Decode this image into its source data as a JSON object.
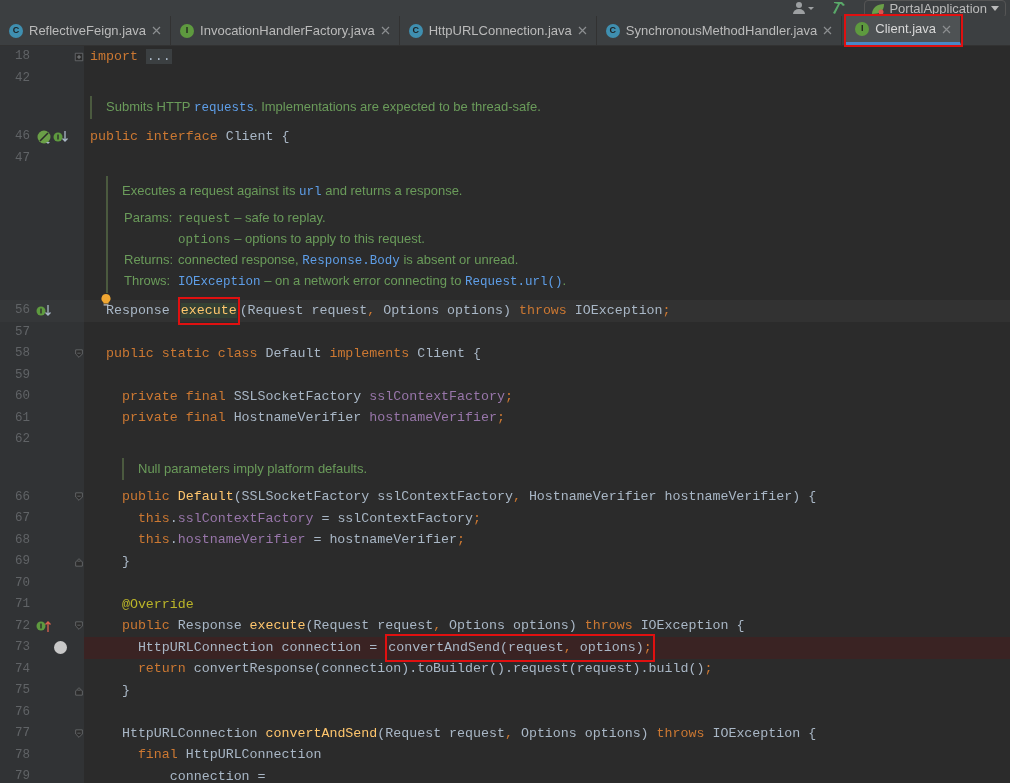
{
  "toolbar": {
    "run_config": "PortalApplication"
  },
  "tabs": [
    {
      "label": "ReflectiveFeign.java",
      "icon": "C",
      "kind": "class",
      "selected": false,
      "annotated": false
    },
    {
      "label": "InvocationHandlerFactory.java",
      "icon": "I",
      "kind": "interface",
      "selected": false,
      "annotated": false
    },
    {
      "label": "HttpURLConnection.java",
      "icon": "C",
      "kind": "class",
      "selected": false,
      "annotated": false
    },
    {
      "label": "SynchronousMethodHandler.java",
      "icon": "C",
      "kind": "class",
      "selected": false,
      "annotated": false
    },
    {
      "label": "Client.java",
      "icon": "I",
      "kind": "interface",
      "selected": true,
      "annotated": true
    }
  ],
  "editor": {
    "lines": [
      {
        "kind": "code",
        "number": "18",
        "fold": {
          "kind": "collapsed"
        },
        "tokens": [
          {
            "t": "import ",
            "kind": "kw"
          },
          {
            "t": "...",
            "kind": "folded"
          }
        ]
      },
      {
        "kind": "code",
        "number": "42"
      },
      {
        "kind": "doc",
        "rows": [
          {
            "parts": [
              {
                "t": "Submits HTTP "
              },
              {
                "t": "requests",
                "kind": "link"
              },
              {
                "t": ". Implementations are expected to be thread-safe."
              }
            ]
          }
        ]
      },
      {
        "kind": "code",
        "number": "46",
        "gutter": [
          {
            "kind": "leaf"
          },
          {
            "kind": "impl-down"
          }
        ],
        "tokens": [
          {
            "t": "public ",
            "kind": "kw"
          },
          {
            "t": "interface ",
            "kind": "kw"
          },
          {
            "t": "Client {"
          }
        ]
      },
      {
        "kind": "code",
        "number": "47"
      },
      {
        "kind": "doc",
        "bulb": true,
        "rows": [
          {
            "parts": [
              {
                "t": "Executes a request against its "
              },
              {
                "t": "url",
                "kind": "link"
              },
              {
                "t": " and returns a response."
              }
            ]
          },
          {
            "label": "Params:",
            "parts": [
              {
                "t": "request",
                "kind": "param"
              },
              {
                "t": " – safe to replay."
              }
            ]
          },
          {
            "parts": [
              {
                "t": "options",
                "kind": "param"
              },
              {
                "t": " – options to apply to this request."
              }
            ]
          },
          {
            "label": "Returns:",
            "parts": [
              {
                "t": "connected response, "
              },
              {
                "t": "Response.Body",
                "kind": "link"
              },
              {
                "t": " is absent or unread."
              }
            ]
          },
          {
            "label": "Throws:",
            "parts": [
              {
                "t": "IOException",
                "kind": "link"
              },
              {
                "t": " – on a network error connecting to "
              },
              {
                "t": "Request.url()",
                "kind": "link"
              },
              {
                "t": "."
              }
            ]
          }
        ]
      },
      {
        "kind": "code",
        "number": "56",
        "current": true,
        "gutter": [
          {
            "kind": "impl-down"
          }
        ],
        "tokens": [
          {
            "t": "  Response "
          },
          {
            "t": "execute",
            "kind": "fn",
            "boxed": true,
            "caret": true
          },
          {
            "t": "(Request request"
          },
          {
            "t": ", ",
            "kind": "kw"
          },
          {
            "t": "Options options) "
          },
          {
            "t": "throws ",
            "kind": "kw"
          },
          {
            "t": "IOException"
          },
          {
            "t": ";",
            "kind": "kw"
          }
        ]
      },
      {
        "kind": "code",
        "number": "57"
      },
      {
        "kind": "code",
        "number": "58",
        "fold": {
          "kind": "start"
        },
        "tokens": [
          {
            "t": "  public static class ",
            "kind": "kw"
          },
          {
            "t": "Default "
          },
          {
            "t": "implements ",
            "kind": "kw"
          },
          {
            "t": "Client {"
          }
        ]
      },
      {
        "kind": "code",
        "number": "59"
      },
      {
        "kind": "code",
        "number": "60",
        "tokens": [
          {
            "t": "    private final ",
            "kind": "kw"
          },
          {
            "t": "SSLSocketFactory "
          },
          {
            "t": "sslContextFactory",
            "kind": "field"
          },
          {
            "t": ";",
            "kind": "kw"
          }
        ]
      },
      {
        "kind": "code",
        "number": "61",
        "tokens": [
          {
            "t": "    private final ",
            "kind": "kw"
          },
          {
            "t": "HostnameVerifier "
          },
          {
            "t": "hostnameVerifier",
            "kind": "field"
          },
          {
            "t": ";",
            "kind": "kw"
          }
        ]
      },
      {
        "kind": "code",
        "number": "62"
      },
      {
        "kind": "doc",
        "rows": [
          {
            "parts": [
              {
                "t": "Null parameters imply platform defaults."
              }
            ]
          }
        ]
      },
      {
        "kind": "code",
        "number": "66",
        "fold": {
          "kind": "start"
        },
        "tokens": [
          {
            "t": "    public ",
            "kind": "kw"
          },
          {
            "t": "Default",
            "kind": "fn"
          },
          {
            "t": "(SSLSocketFactory sslContextFactory"
          },
          {
            "t": ", ",
            "kind": "kw"
          },
          {
            "t": "HostnameVerifier hostnameVerifier) {"
          }
        ]
      },
      {
        "kind": "code",
        "number": "67",
        "tokens": [
          {
            "t": "      this",
            "kind": "kw"
          },
          {
            "t": "."
          },
          {
            "t": "sslContextFactory",
            "kind": "field"
          },
          {
            "t": " = sslContextFactory"
          },
          {
            "t": ";",
            "kind": "kw"
          }
        ]
      },
      {
        "kind": "code",
        "number": "68",
        "tokens": [
          {
            "t": "      this",
            "kind": "kw"
          },
          {
            "t": "."
          },
          {
            "t": "hostnameVerifier",
            "kind": "field"
          },
          {
            "t": " = hostnameVerifier"
          },
          {
            "t": ";",
            "kind": "kw"
          }
        ]
      },
      {
        "kind": "code",
        "number": "69",
        "fold": {
          "kind": "end"
        },
        "tokens": [
          {
            "t": "    }"
          }
        ]
      },
      {
        "kind": "code",
        "number": "70"
      },
      {
        "kind": "code",
        "number": "71",
        "tokens": [
          {
            "t": "    @Override",
            "kind": "ann"
          }
        ]
      },
      {
        "kind": "code",
        "number": "72",
        "fold": {
          "kind": "start"
        },
        "gutter": [
          {
            "kind": "impl-up"
          }
        ],
        "tokens": [
          {
            "t": "    public ",
            "kind": "kw"
          },
          {
            "t": "Response "
          },
          {
            "t": "execute",
            "kind": "fn"
          },
          {
            "t": "(Request request"
          },
          {
            "t": ", ",
            "kind": "kw"
          },
          {
            "t": "Options options) "
          },
          {
            "t": "throws ",
            "kind": "kw"
          },
          {
            "t": "IOException {"
          }
        ]
      },
      {
        "kind": "code",
        "number": "73",
        "breakpoint": true,
        "tokens": [
          {
            "t": "      HttpURLConnection connection = "
          },
          {
            "t": "convertAndSend(request",
            "boxed": true
          },
          {
            "t": ", ",
            "kind": "kw",
            "boxed": true
          },
          {
            "t": "options)",
            "boxed": true
          },
          {
            "t": ";",
            "kind": "kw",
            "boxed": true
          }
        ]
      },
      {
        "kind": "code",
        "number": "74",
        "tokens": [
          {
            "t": "      return ",
            "kind": "kw"
          },
          {
            "t": "convertResponse(connection).toBuilder().request(request).build()"
          },
          {
            "t": ";",
            "kind": "kw"
          }
        ]
      },
      {
        "kind": "code",
        "number": "75",
        "fold": {
          "kind": "end"
        },
        "tokens": [
          {
            "t": "    }"
          }
        ]
      },
      {
        "kind": "code",
        "number": "76"
      },
      {
        "kind": "code",
        "number": "77",
        "fold": {
          "kind": "start"
        },
        "tokens": [
          {
            "t": "    HttpURLConnection "
          },
          {
            "t": "convertAndSend",
            "kind": "fn"
          },
          {
            "t": "(Request request"
          },
          {
            "t": ", ",
            "kind": "kw"
          },
          {
            "t": "Options options) "
          },
          {
            "t": "throws ",
            "kind": "kw"
          },
          {
            "t": "IOException {"
          }
        ]
      },
      {
        "kind": "code",
        "number": "78",
        "tokens": [
          {
            "t": "      final ",
            "kind": "kw"
          },
          {
            "t": "HttpURLConnection"
          }
        ]
      },
      {
        "kind": "code",
        "number": "79",
        "tokens": [
          {
            "t": "          connection ="
          }
        ]
      }
    ]
  }
}
